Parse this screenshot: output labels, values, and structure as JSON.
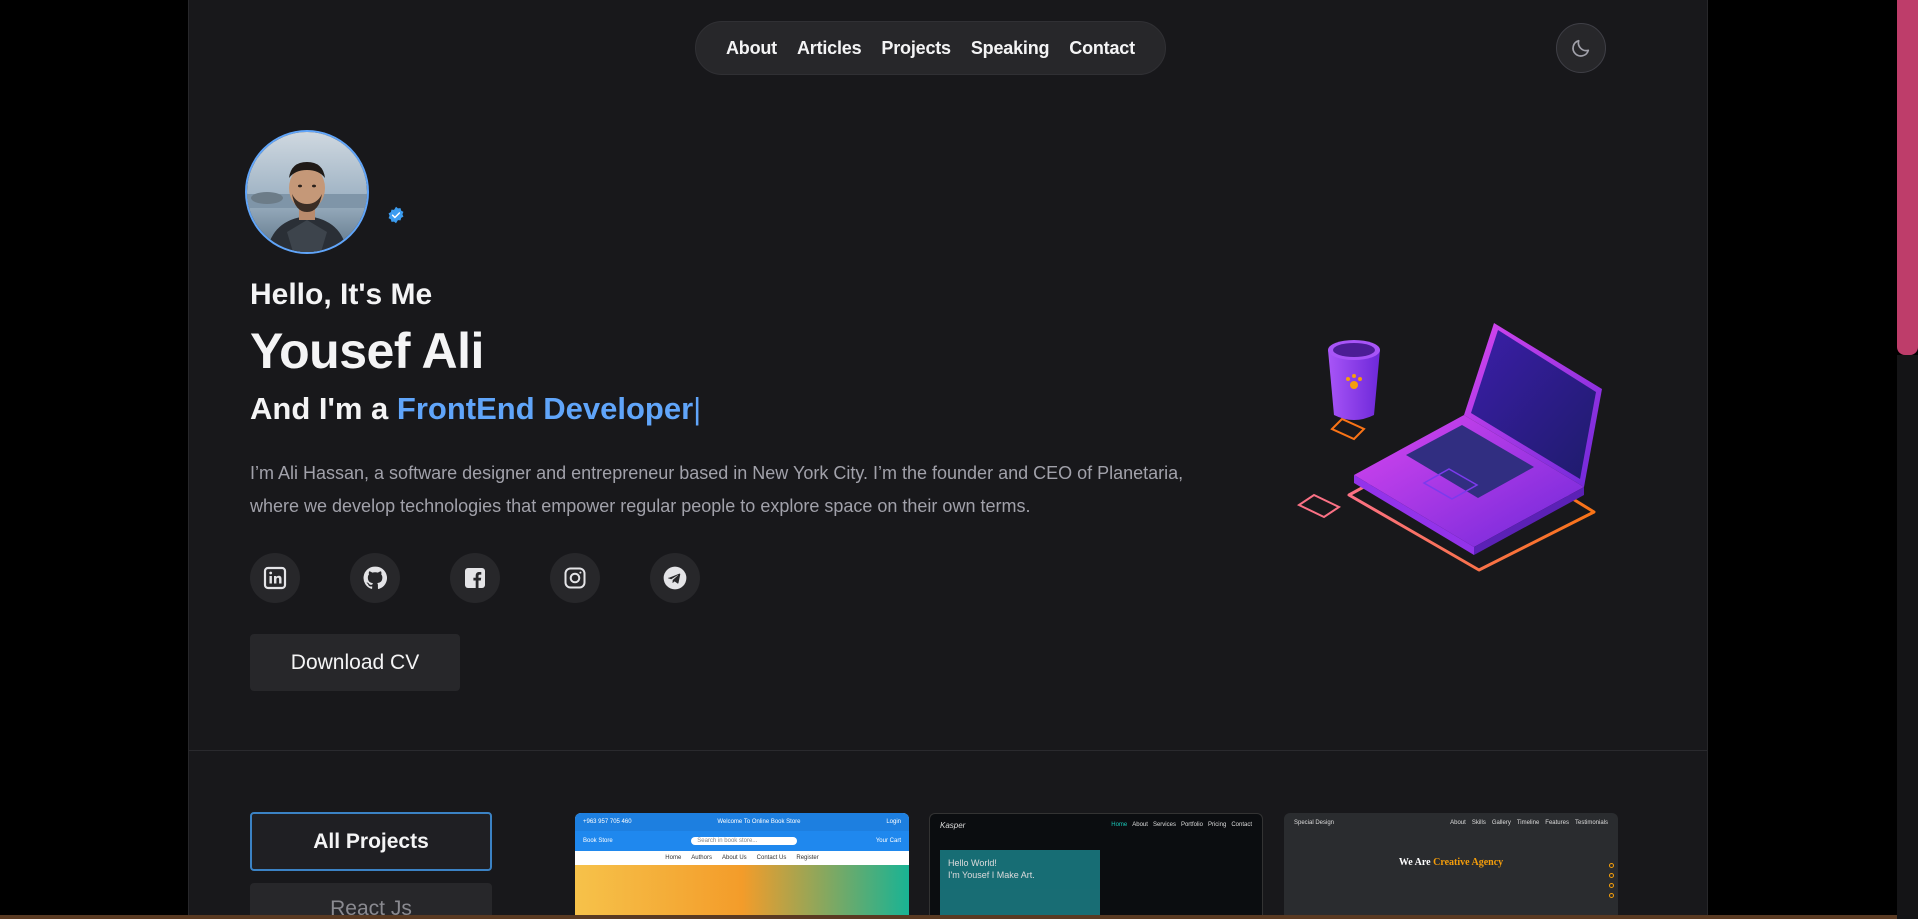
{
  "nav": {
    "items": [
      "About",
      "Articles",
      "Projects",
      "Speaking",
      "Contact"
    ]
  },
  "theme_toggle_icon": "moon-icon",
  "hero": {
    "greeting": "Hello, It's Me",
    "name": "Yousef Ali",
    "role_prefix": "And I'm a ",
    "role_highlight": "FrontEnd Developer",
    "role_caret": "|",
    "bio": "I’m Ali Hassan, a software designer and entrepreneur based in New York City. I’m the founder and CEO of Planetaria, where we develop technologies that empower regular people to explore space on their own terms.",
    "download_cv": "Download CV"
  },
  "socials": [
    "linkedin-icon",
    "github-icon",
    "facebook-icon",
    "instagram-icon",
    "telegram-icon"
  ],
  "projects": {
    "filters": [
      "All Projects",
      "React Js"
    ],
    "cards": [
      {
        "topbar_left": "+963 957 705 460",
        "topbar_center": "Welcome To Online Book Store",
        "topbar_right": "Login",
        "logo": "Book Store",
        "search_placeholder": "Search in book store...",
        "cart": "Your Cart",
        "menu": [
          "Home",
          "Authors",
          "About Us",
          "Contact Us",
          "Register"
        ]
      },
      {
        "logo": "Kasper",
        "menu": [
          "Home",
          "About",
          "Services",
          "Portfolio",
          "Pricing",
          "Contact"
        ],
        "hero_line1": "Hello World!",
        "hero_line2": "I'm Yousef I Make Art."
      },
      {
        "logo": "Special Design",
        "menu": [
          "About",
          "Skills",
          "Gallery",
          "Timeline",
          "Features",
          "Testimonials"
        ],
        "hero_prefix": "We Are ",
        "hero_highlight": "Creative Agency"
      }
    ]
  },
  "colors": {
    "accent": "#60a5fa",
    "background": "#18181b",
    "surface": "#27272a",
    "scrollbar": "#be3d6a"
  }
}
